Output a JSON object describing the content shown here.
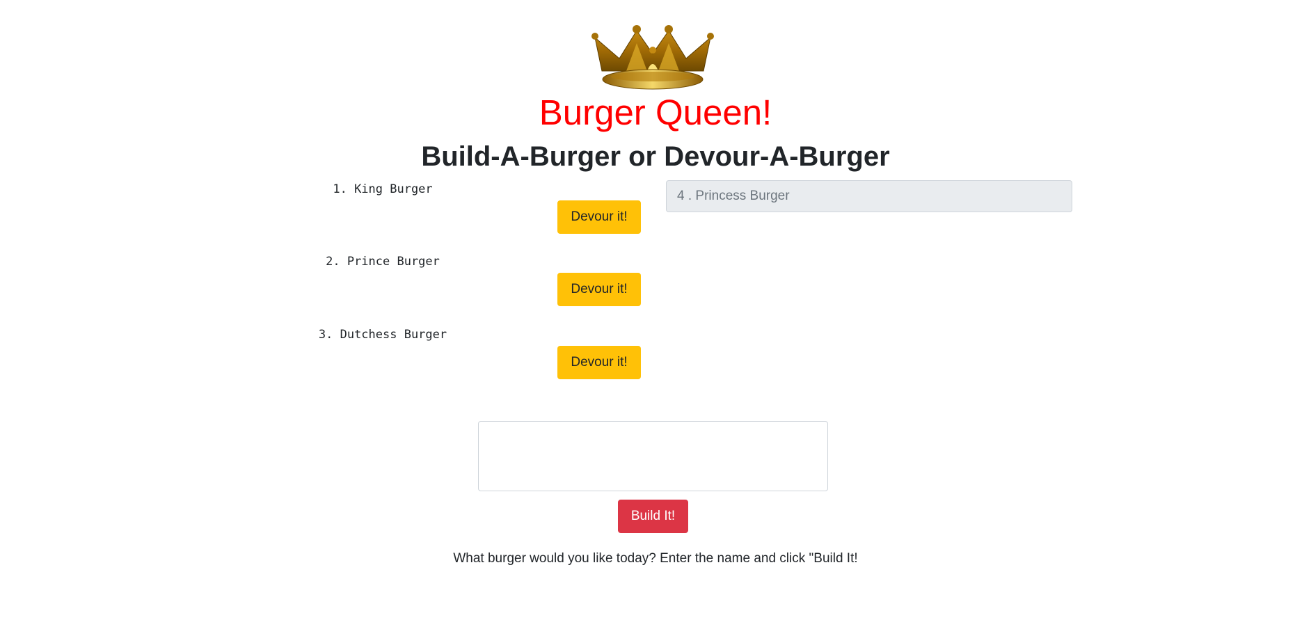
{
  "header": {
    "logo_icon": "crown-icon",
    "title": "Burger Queen!",
    "subtitle": "Build-A-Burger or Devour-A-Burger"
  },
  "burgers": [
    {
      "number": "1.",
      "name": "King Burger",
      "button_label": "Devour it!"
    },
    {
      "number": "2.",
      "name": "Prince Burger",
      "button_label": "Devour it!"
    },
    {
      "number": "3.",
      "name": "Dutchess Burger",
      "button_label": "Devour it!"
    }
  ],
  "devoured": [
    {
      "label": "4 . Princess Burger"
    }
  ],
  "form": {
    "input_value": "",
    "build_label": "Build It!",
    "hint": "What burger would you like today? Enter the name and click \"Build It!"
  },
  "colors": {
    "title": "#ff0000",
    "devour_button": "#ffc107",
    "build_button": "#dc3545",
    "devoured_bg": "#e9ecef"
  }
}
